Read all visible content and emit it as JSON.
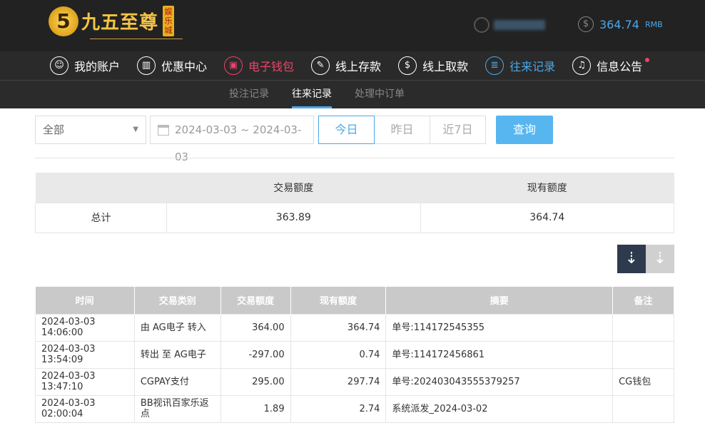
{
  "header": {
    "logo_num": "5",
    "logo_name": "九五至尊",
    "logo_tag": "娱乐城",
    "balance": "364.74",
    "currency": "RMB"
  },
  "nav": [
    {
      "label": "我的账户",
      "icon": "user-icon",
      "glyph": "☺"
    },
    {
      "label": "优惠中心",
      "icon": "gift-icon",
      "glyph": "▥"
    },
    {
      "label": "电子钱包",
      "icon": "wallet-icon",
      "glyph": "▣"
    },
    {
      "label": "线上存款",
      "icon": "deposit-icon",
      "glyph": "✎"
    },
    {
      "label": "线上取款",
      "icon": "withdraw-icon",
      "glyph": "$"
    },
    {
      "label": "往来记录",
      "icon": "records-icon",
      "glyph": "≣"
    },
    {
      "label": "信息公告",
      "icon": "bell-icon",
      "glyph": "♫"
    }
  ],
  "subnav": [
    "投注记录",
    "往来记录",
    "处理中订单"
  ],
  "filter": {
    "type": "全部",
    "date_range": "2024-03-03 ~ 2024-03-03",
    "quick": [
      "今日",
      "昨日",
      "近7日"
    ],
    "query": "查询"
  },
  "summary": {
    "headers": [
      "",
      "交易额度",
      "现有额度"
    ],
    "row": [
      "总计",
      "363.89",
      "364.74"
    ]
  },
  "table": {
    "headers": [
      "时间",
      "交易类别",
      "交易额度",
      "现有额度",
      "摘要",
      "备注"
    ],
    "rows": [
      [
        "2024-03-03 14:06:00",
        "由 AG电子 转入",
        "364.00",
        "364.74",
        "单号:114172545355",
        ""
      ],
      [
        "2024-03-03 13:54:09",
        "转出 至 AG电子",
        "-297.00",
        "0.74",
        "单号:114172456861",
        ""
      ],
      [
        "2024-03-03 13:47:10",
        "CGPAY支付",
        "295.00",
        "297.74",
        "单号:202403043555379257",
        "CG钱包"
      ],
      [
        "2024-03-03 02:00:04",
        "BB视讯百家乐返点",
        "1.89",
        "2.74",
        "系统派发_2024-03-02",
        ""
      ]
    ]
  }
}
